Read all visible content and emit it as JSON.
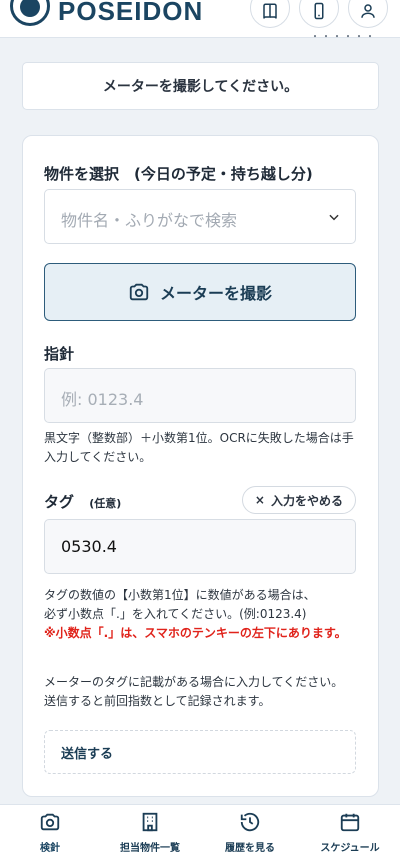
{
  "header": {
    "logo_text": "POSEIDON",
    "sub_text": "・・・・・・"
  },
  "notice": {
    "text": "メーターを撮影してください。"
  },
  "form": {
    "property_label": "物件を選択　(今日の予定・持ち越し分)",
    "property_placeholder": "物件名・ふりがなで検索",
    "camera_button": "メーターを撮影",
    "reading_label": "指針",
    "reading_placeholder": "例: 0123.4",
    "reading_help": "黒文字（整数部）＋小数第1位。OCRに失敗した場合は手入力してください。",
    "tag_label": "タグ",
    "tag_optional": "(任意)",
    "cancel_input": "入力をやめる",
    "tag_value": "0530.4",
    "tag_help_1": "タグの数値の【小数第1位】に数値がある場合は、",
    "tag_help_2": "必ず小数点「.」を入れてください。(例:0123.4)",
    "tag_warning": "※小数点「.」は、スマホのテンキーの左下にあります。",
    "tag_note_1": "メーターのタグに記載がある場合に入力してください。",
    "tag_note_2": "送信すると前回指数として記録されます。",
    "submit": "送信する"
  },
  "bottom_nav": {
    "items": [
      {
        "label": "検針",
        "icon": "camera-icon"
      },
      {
        "label": "担当物件一覧",
        "icon": "building-icon"
      },
      {
        "label": "履歴を見る",
        "icon": "history-icon"
      },
      {
        "label": "スケジュール",
        "icon": "calendar-icon"
      }
    ]
  },
  "colors": {
    "primary": "#1b4562",
    "warning": "#e0231b",
    "background": "#eef2f6"
  }
}
